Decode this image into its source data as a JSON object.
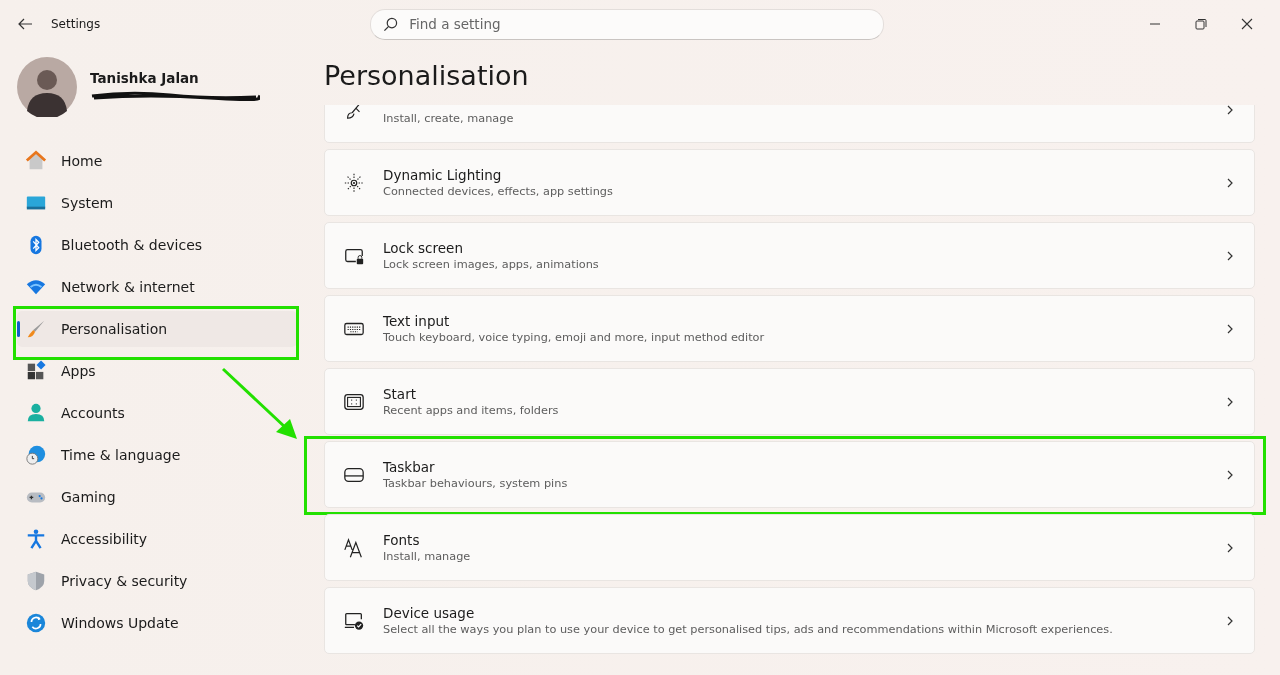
{
  "window": {
    "title": "Settings"
  },
  "search": {
    "placeholder": "Find a setting"
  },
  "profile": {
    "name": "Tanishka Jalan"
  },
  "nav": [
    {
      "label": "Home",
      "selected": false,
      "highlighted": false
    },
    {
      "label": "System",
      "selected": false,
      "highlighted": false
    },
    {
      "label": "Bluetooth & devices",
      "selected": false,
      "highlighted": false
    },
    {
      "label": "Network & internet",
      "selected": false,
      "highlighted": false
    },
    {
      "label": "Personalisation",
      "selected": true,
      "highlighted": true
    },
    {
      "label": "Apps",
      "selected": false,
      "highlighted": false
    },
    {
      "label": "Accounts",
      "selected": false,
      "highlighted": false
    },
    {
      "label": "Time & language",
      "selected": false,
      "highlighted": false
    },
    {
      "label": "Gaming",
      "selected": false,
      "highlighted": false
    },
    {
      "label": "Accessibility",
      "selected": false,
      "highlighted": false
    },
    {
      "label": "Privacy & security",
      "selected": false,
      "highlighted": false
    },
    {
      "label": "Windows Update",
      "selected": false,
      "highlighted": false
    }
  ],
  "page_title": "Personalisation",
  "cards": [
    {
      "subtitle": "Install, create, manage",
      "highlighted": false
    },
    {
      "title": "Dynamic Lighting",
      "subtitle": "Connected devices, effects, app settings",
      "highlighted": false
    },
    {
      "title": "Lock screen",
      "subtitle": "Lock screen images, apps, animations",
      "highlighted": false
    },
    {
      "title": "Text input",
      "subtitle": "Touch keyboard, voice typing, emoji and more, input method editor",
      "highlighted": false
    },
    {
      "title": "Start",
      "subtitle": "Recent apps and items, folders",
      "highlighted": false
    },
    {
      "title": "Taskbar",
      "subtitle": "Taskbar behaviours, system pins",
      "highlighted": true
    },
    {
      "title": "Fonts",
      "subtitle": "Install, manage",
      "highlighted": false
    },
    {
      "title": "Device usage",
      "subtitle": "Select all the ways you plan to use your device to get personalised tips, ads and recommendations within Microsoft experiences.",
      "highlighted": false
    }
  ]
}
